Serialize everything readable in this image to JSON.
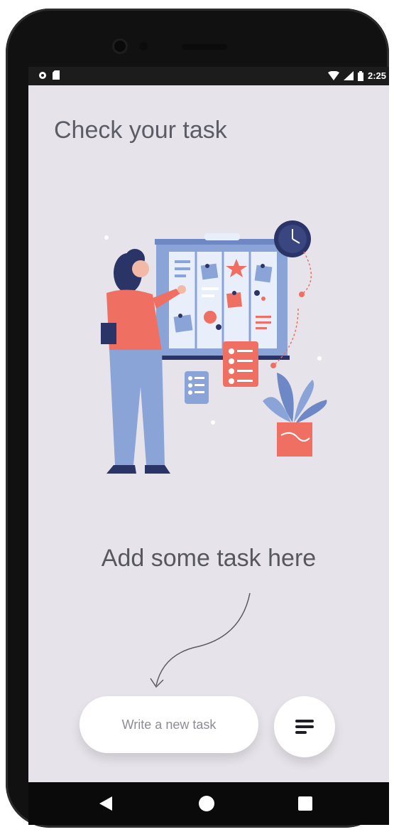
{
  "status_bar": {
    "time": "2:25",
    "icons": [
      "sync-icon",
      "sd-card-icon",
      "wifi-icon",
      "signal-icon",
      "battery-icon"
    ]
  },
  "screen": {
    "title": "Check your task",
    "hint": "Add some task here"
  },
  "composer": {
    "placeholder": "Write a new task",
    "menu_icon": "menu-lines-icon"
  },
  "nav_bar": {
    "icons": [
      "back-icon",
      "home-icon",
      "recents-icon"
    ]
  },
  "colors": {
    "background": "#e6e4ea",
    "accent_coral": "#ef6f62",
    "accent_blue": "#8aa4d8",
    "navy": "#2b3466"
  }
}
